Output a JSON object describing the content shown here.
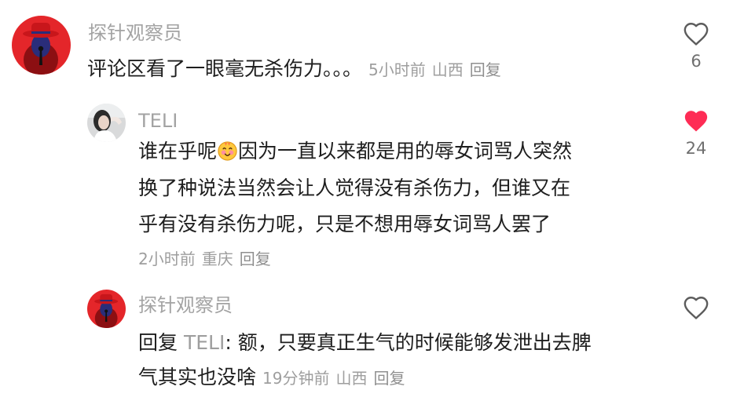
{
  "comments": [
    {
      "username": "探针观察员",
      "text": "评论区看了一眼毫无杀伤力。。。",
      "time": "5小时前",
      "location": "山西",
      "reply_label": "回复",
      "likes": "6",
      "liked": false
    },
    {
      "username": "TELI",
      "text_line1_a": "谁在乎呢",
      "text_line1_b": "因为一直以来都是用的辱女词骂人突然",
      "text_line2": "换了种说法当然会让人觉得没有杀伤力，但谁又在",
      "text_line3": "乎有没有杀伤力呢，只是不想用辱女词骂人罢了",
      "time": "2小时前",
      "location": "重庆",
      "reply_label": "回复",
      "likes": "24",
      "liked": true
    },
    {
      "username": "探针观察员",
      "reply_prefix": "回复",
      "reply_to": "TELI",
      "text_line1": ": 额，只要真正生气的时候能够发泄出去脾",
      "text_line2": "气其实也没啥",
      "time": "19分钟前",
      "location": "山西",
      "reply_label": "回复",
      "liked": false
    }
  ],
  "colors": {
    "liked_heart": "#fe2c55",
    "meta_gray": "#9e9e9e",
    "text": "#1e1e1e"
  },
  "icons": [
    "heart-outline-icon",
    "heart-filled-icon",
    "smiling-face-emoji"
  ]
}
